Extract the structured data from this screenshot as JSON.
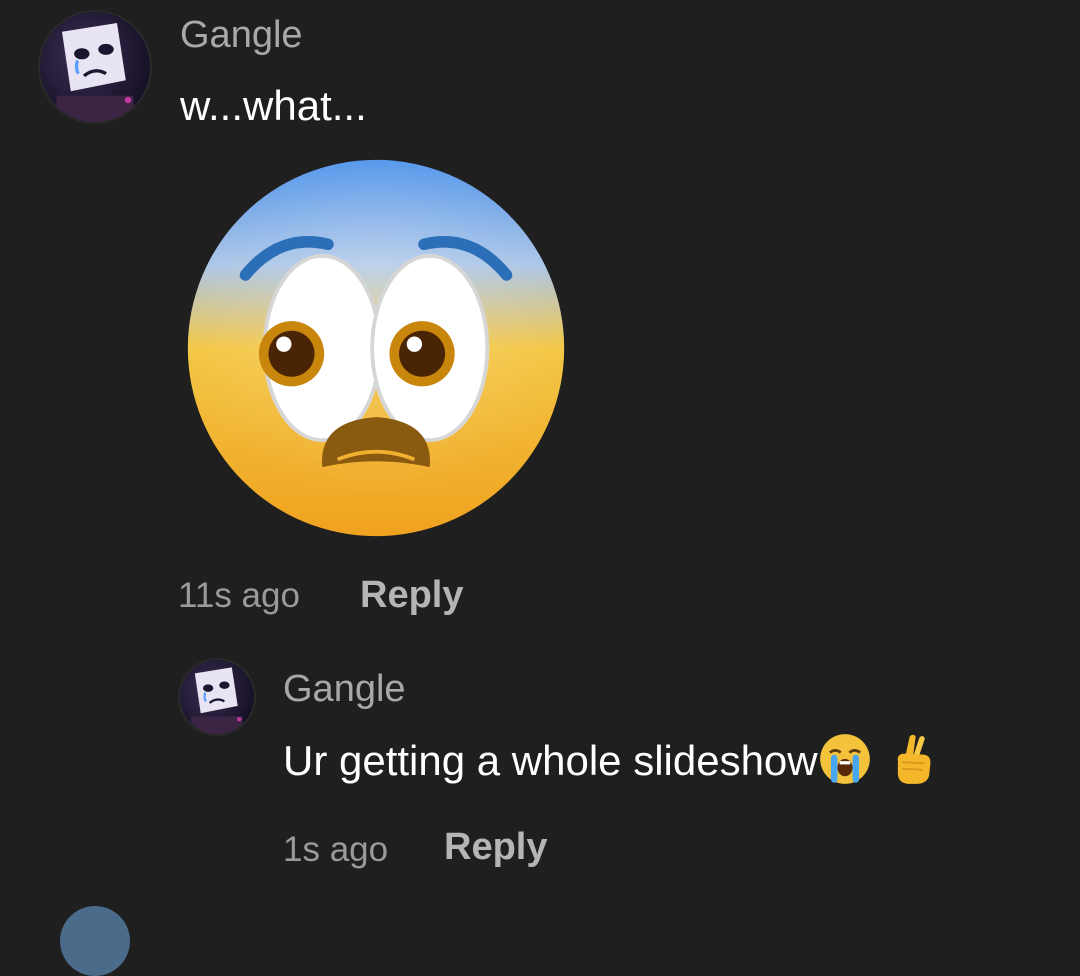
{
  "comments": [
    {
      "username": "Gangle",
      "text": "w...what...",
      "sticker": "fearful-face-emoji",
      "time": "11s ago",
      "reply_label": "Reply"
    },
    {
      "username": "Gangle",
      "text": "Ur getting a whole slideshow",
      "emojis": [
        "loudly-crying-face-emoji",
        "crossed-fingers-emoji"
      ],
      "time": "1s ago",
      "reply_label": "Reply"
    }
  ],
  "colors": {
    "background": "#1f1f1f",
    "username": "#a8a8a8",
    "text": "#ffffff",
    "meta": "#9a9a9a"
  }
}
